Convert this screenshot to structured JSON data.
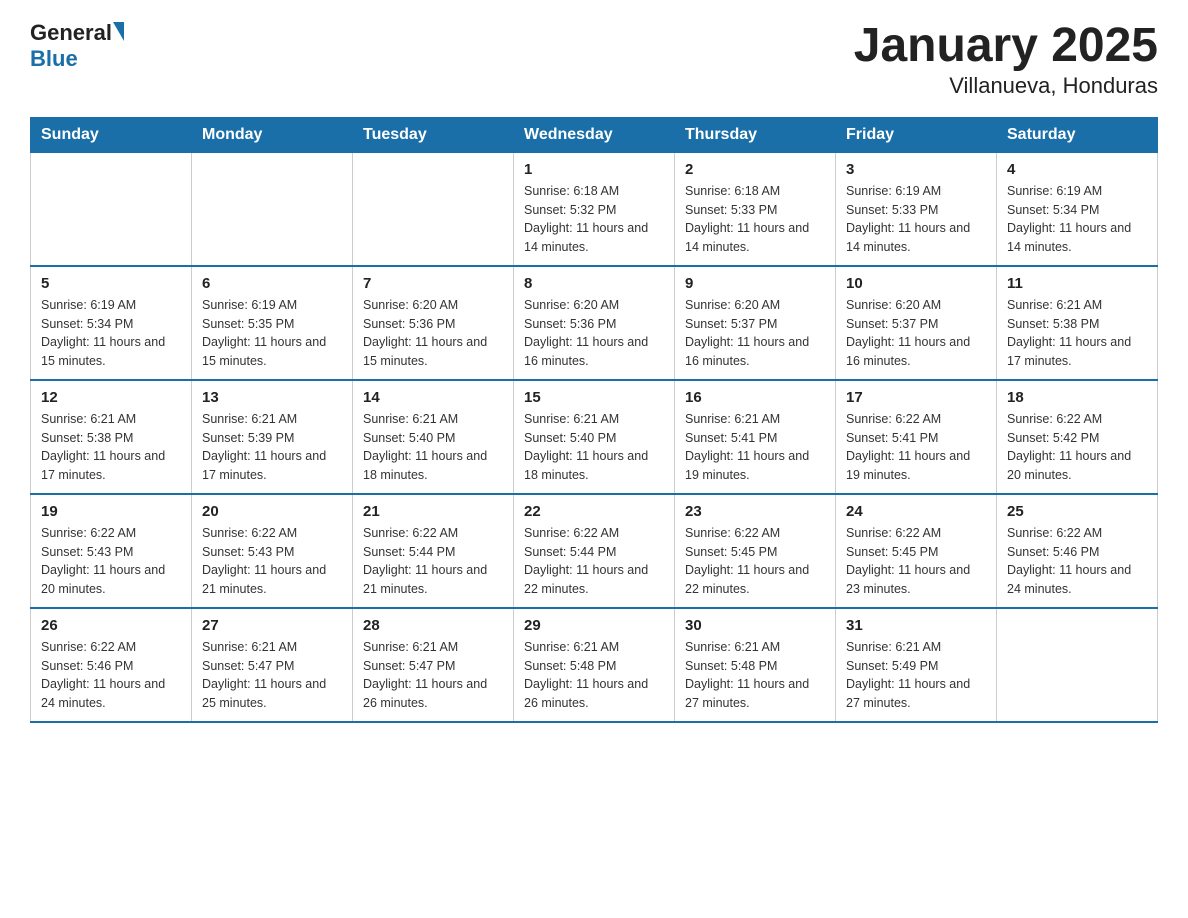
{
  "header": {
    "logo_general": "General",
    "logo_blue": "Blue",
    "title": "January 2025",
    "subtitle": "Villanueva, Honduras"
  },
  "calendar": {
    "days_of_week": [
      "Sunday",
      "Monday",
      "Tuesday",
      "Wednesday",
      "Thursday",
      "Friday",
      "Saturday"
    ],
    "weeks": [
      [
        {
          "num": "",
          "info": ""
        },
        {
          "num": "",
          "info": ""
        },
        {
          "num": "",
          "info": ""
        },
        {
          "num": "1",
          "info": "Sunrise: 6:18 AM\nSunset: 5:32 PM\nDaylight: 11 hours and 14 minutes."
        },
        {
          "num": "2",
          "info": "Sunrise: 6:18 AM\nSunset: 5:33 PM\nDaylight: 11 hours and 14 minutes."
        },
        {
          "num": "3",
          "info": "Sunrise: 6:19 AM\nSunset: 5:33 PM\nDaylight: 11 hours and 14 minutes."
        },
        {
          "num": "4",
          "info": "Sunrise: 6:19 AM\nSunset: 5:34 PM\nDaylight: 11 hours and 14 minutes."
        }
      ],
      [
        {
          "num": "5",
          "info": "Sunrise: 6:19 AM\nSunset: 5:34 PM\nDaylight: 11 hours and 15 minutes."
        },
        {
          "num": "6",
          "info": "Sunrise: 6:19 AM\nSunset: 5:35 PM\nDaylight: 11 hours and 15 minutes."
        },
        {
          "num": "7",
          "info": "Sunrise: 6:20 AM\nSunset: 5:36 PM\nDaylight: 11 hours and 15 minutes."
        },
        {
          "num": "8",
          "info": "Sunrise: 6:20 AM\nSunset: 5:36 PM\nDaylight: 11 hours and 16 minutes."
        },
        {
          "num": "9",
          "info": "Sunrise: 6:20 AM\nSunset: 5:37 PM\nDaylight: 11 hours and 16 minutes."
        },
        {
          "num": "10",
          "info": "Sunrise: 6:20 AM\nSunset: 5:37 PM\nDaylight: 11 hours and 16 minutes."
        },
        {
          "num": "11",
          "info": "Sunrise: 6:21 AM\nSunset: 5:38 PM\nDaylight: 11 hours and 17 minutes."
        }
      ],
      [
        {
          "num": "12",
          "info": "Sunrise: 6:21 AM\nSunset: 5:38 PM\nDaylight: 11 hours and 17 minutes."
        },
        {
          "num": "13",
          "info": "Sunrise: 6:21 AM\nSunset: 5:39 PM\nDaylight: 11 hours and 17 minutes."
        },
        {
          "num": "14",
          "info": "Sunrise: 6:21 AM\nSunset: 5:40 PM\nDaylight: 11 hours and 18 minutes."
        },
        {
          "num": "15",
          "info": "Sunrise: 6:21 AM\nSunset: 5:40 PM\nDaylight: 11 hours and 18 minutes."
        },
        {
          "num": "16",
          "info": "Sunrise: 6:21 AM\nSunset: 5:41 PM\nDaylight: 11 hours and 19 minutes."
        },
        {
          "num": "17",
          "info": "Sunrise: 6:22 AM\nSunset: 5:41 PM\nDaylight: 11 hours and 19 minutes."
        },
        {
          "num": "18",
          "info": "Sunrise: 6:22 AM\nSunset: 5:42 PM\nDaylight: 11 hours and 20 minutes."
        }
      ],
      [
        {
          "num": "19",
          "info": "Sunrise: 6:22 AM\nSunset: 5:43 PM\nDaylight: 11 hours and 20 minutes."
        },
        {
          "num": "20",
          "info": "Sunrise: 6:22 AM\nSunset: 5:43 PM\nDaylight: 11 hours and 21 minutes."
        },
        {
          "num": "21",
          "info": "Sunrise: 6:22 AM\nSunset: 5:44 PM\nDaylight: 11 hours and 21 minutes."
        },
        {
          "num": "22",
          "info": "Sunrise: 6:22 AM\nSunset: 5:44 PM\nDaylight: 11 hours and 22 minutes."
        },
        {
          "num": "23",
          "info": "Sunrise: 6:22 AM\nSunset: 5:45 PM\nDaylight: 11 hours and 22 minutes."
        },
        {
          "num": "24",
          "info": "Sunrise: 6:22 AM\nSunset: 5:45 PM\nDaylight: 11 hours and 23 minutes."
        },
        {
          "num": "25",
          "info": "Sunrise: 6:22 AM\nSunset: 5:46 PM\nDaylight: 11 hours and 24 minutes."
        }
      ],
      [
        {
          "num": "26",
          "info": "Sunrise: 6:22 AM\nSunset: 5:46 PM\nDaylight: 11 hours and 24 minutes."
        },
        {
          "num": "27",
          "info": "Sunrise: 6:21 AM\nSunset: 5:47 PM\nDaylight: 11 hours and 25 minutes."
        },
        {
          "num": "28",
          "info": "Sunrise: 6:21 AM\nSunset: 5:47 PM\nDaylight: 11 hours and 26 minutes."
        },
        {
          "num": "29",
          "info": "Sunrise: 6:21 AM\nSunset: 5:48 PM\nDaylight: 11 hours and 26 minutes."
        },
        {
          "num": "30",
          "info": "Sunrise: 6:21 AM\nSunset: 5:48 PM\nDaylight: 11 hours and 27 minutes."
        },
        {
          "num": "31",
          "info": "Sunrise: 6:21 AM\nSunset: 5:49 PM\nDaylight: 11 hours and 27 minutes."
        },
        {
          "num": "",
          "info": ""
        }
      ]
    ]
  }
}
